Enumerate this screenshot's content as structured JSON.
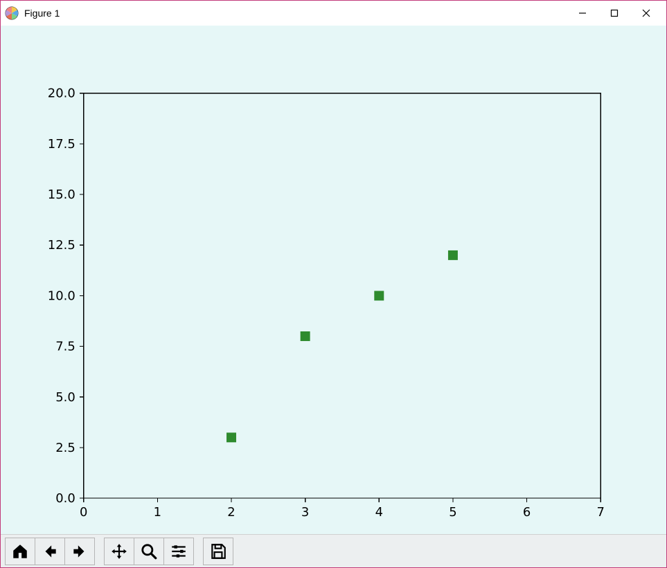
{
  "window": {
    "title": "Figure 1",
    "controls": {
      "minimize": "Minimize",
      "maximize": "Maximize",
      "close": "Close"
    }
  },
  "toolbar": {
    "home": "Home",
    "back": "Back",
    "forward": "Forward",
    "pan": "Pan",
    "zoom": "Zoom",
    "configure": "Configure subplots",
    "save": "Save figure"
  },
  "chart_data": {
    "type": "scatter",
    "x": [
      2,
      3,
      4,
      5
    ],
    "y": [
      3,
      8,
      10,
      12
    ],
    "xlabel": "",
    "ylabel": "",
    "title": "",
    "xlim": [
      0,
      7
    ],
    "ylim": [
      0,
      20
    ],
    "xticks": [
      0,
      1,
      2,
      3,
      4,
      5,
      6,
      7
    ],
    "yticks": [
      0.0,
      2.5,
      5.0,
      7.5,
      10.0,
      12.5,
      15.0,
      17.5,
      20.0
    ],
    "xtick_labels": [
      "0",
      "1",
      "2",
      "3",
      "4",
      "5",
      "6",
      "7"
    ],
    "ytick_labels": [
      "0.0",
      "2.5",
      "5.0",
      "7.5",
      "10.0",
      "12.5",
      "15.0",
      "17.5",
      "20.0"
    ],
    "marker": {
      "shape": "square",
      "size": 14,
      "color": "#2e8b2e"
    },
    "background": "#e6f7f7"
  }
}
